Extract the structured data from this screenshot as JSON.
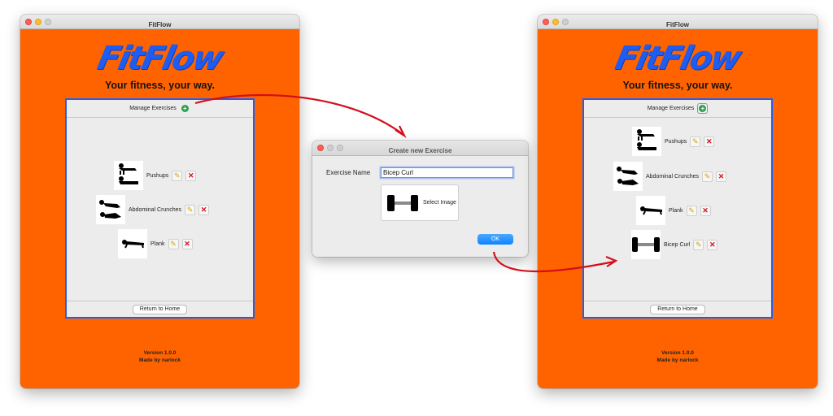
{
  "colors": {
    "window_bg": "#ff6300",
    "accent_blue": "#1f5ff0",
    "arrow_red": "#d40f1a"
  },
  "left_window": {
    "title": "FitFlow",
    "logo": "FitFlow",
    "tagline": "Your fitness, your way.",
    "manage_label": "Manage Exercises",
    "add_icon": "plus-circle-icon",
    "exercises": [
      {
        "name": "Pushups",
        "image": "pushups-icon"
      },
      {
        "name": "Abdominal Crunches",
        "image": "crunches-icon"
      },
      {
        "name": "Plank",
        "image": "plank-icon"
      }
    ],
    "return_label": "Return to Home",
    "version": "Version 1.0.0",
    "author": "Made by narlock"
  },
  "dialog": {
    "title": "Create new Exercise",
    "field_label": "Exercise Name",
    "field_value": "Bicep Curl",
    "select_image_label": "Select Image",
    "image_icon": "dumbbell-icon",
    "ok_label": "OK"
  },
  "right_window": {
    "title": "FitFlow",
    "logo": "FitFlow",
    "tagline": "Your fitness, your way.",
    "manage_label": "Manage Exercises",
    "add_icon": "plus-circle-icon",
    "exercises": [
      {
        "name": "Pushups",
        "image": "pushups-icon"
      },
      {
        "name": "Abdominal Crunches",
        "image": "crunches-icon"
      },
      {
        "name": "Plank",
        "image": "plank-icon"
      },
      {
        "name": "Bicep Curl",
        "image": "dumbbell-icon"
      }
    ],
    "return_label": "Return to Home",
    "version": "Version 1.0.0",
    "author": "Made by narlock"
  }
}
